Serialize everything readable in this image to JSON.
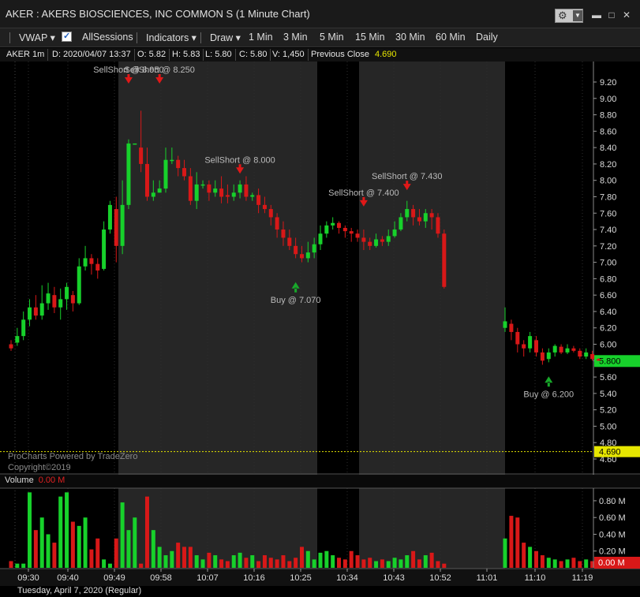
{
  "window": {
    "title": "AKER : AKERS BIOSCIENCES, INC COMMON S (1 Minute Chart)",
    "minimize": "▬",
    "restore": "□",
    "close": "✕"
  },
  "toolbar": {
    "vwap": "VWAP ▾",
    "allsessions": "AllSessions",
    "indicators": "Indicators ▾",
    "draw": "Draw ▾",
    "intervals": [
      "1 Min",
      "3 Min",
      "5 Min",
      "15 Min",
      "30 Min",
      "60 Min",
      "Daily"
    ]
  },
  "infobar": {
    "symbol": "AKER 1m",
    "date": "D: 2020/04/07 13:37",
    "open": "O: 5.82",
    "high": "H: 5.83",
    "low": "L: 5.80",
    "close": "C: 5.80",
    "volume": "V: 1,450",
    "prev_close_label": "Previous Close",
    "prev_close_value": "4.690"
  },
  "credits": {
    "line1": "ProCharts Powered by TradeZero",
    "line2": "Copyright©2019"
  },
  "volume_panel": {
    "label": "Volume",
    "value": "0.00 M"
  },
  "date_label": "Tuesday, April 7, 2020 (Regular)",
  "colors": {
    "up": "#17d12b",
    "down": "#d81818",
    "prev_close": "#e6e600",
    "last_price": "#17d12b",
    "session_band": "#262626"
  },
  "chart_data": {
    "type": "candlestick",
    "ylim": [
      4.5,
      9.3
    ],
    "y_ticks": [
      "9.20",
      "9.00",
      "8.80",
      "8.60",
      "8.40",
      "8.20",
      "8.00",
      "7.80",
      "7.60",
      "7.40",
      "7.20",
      "7.00",
      "6.80",
      "6.60",
      "6.40",
      "6.20",
      "6.00",
      "5.80",
      "5.60",
      "5.40",
      "5.20",
      "5.00",
      "4.80",
      "4.60"
    ],
    "x_ticks": [
      "09:30",
      "09:40",
      "09:49",
      "09:58",
      "10:07",
      "10:16",
      "10:25",
      "10:34",
      "10:43",
      "10:52",
      "11:01",
      "11:10",
      "11:19"
    ],
    "last_price_label": "5.800",
    "last_price": 5.8,
    "prev_close_label": "4.690",
    "prev_close": 4.69,
    "volume_ticks": [
      "0.80 M",
      "0.60 M",
      "0.40 M",
      "0.20 M"
    ],
    "volume_last_label": "0.00 M",
    "vol_ylim": [
      0,
      0.95
    ],
    "candles": [
      [
        6.0,
        5.95,
        6.05,
        5.92
      ],
      [
        6.02,
        6.1,
        6.2,
        5.98
      ],
      [
        6.1,
        6.3,
        6.4,
        6.05
      ],
      [
        6.3,
        6.45,
        6.55,
        6.22
      ],
      [
        6.45,
        6.35,
        6.6,
        6.3
      ],
      [
        6.35,
        6.5,
        6.72,
        6.3
      ],
      [
        6.5,
        6.62,
        6.75,
        6.42
      ],
      [
        6.6,
        6.45,
        6.7,
        6.38
      ],
      [
        6.45,
        6.55,
        6.68,
        6.3
      ],
      [
        6.55,
        6.7,
        6.75,
        6.42
      ],
      [
        6.6,
        6.5,
        6.65,
        6.4
      ],
      [
        6.5,
        6.95,
        7.05,
        6.48
      ],
      [
        6.95,
        7.05,
        7.2,
        6.9
      ],
      [
        7.05,
        6.98,
        7.1,
        6.85
      ],
      [
        6.98,
        6.9,
        7.05,
        6.8
      ],
      [
        6.92,
        7.4,
        7.5,
        6.9
      ],
      [
        7.4,
        7.7,
        7.75,
        7.35
      ],
      [
        7.65,
        7.2,
        7.8,
        7.0
      ],
      [
        7.2,
        7.7,
        8.0,
        7.1
      ],
      [
        7.7,
        8.45,
        8.5,
        7.65
      ],
      [
        8.45,
        8.45,
        8.45,
        8.45
      ],
      [
        8.4,
        8.2,
        8.85,
        8.1
      ],
      [
        8.2,
        7.8,
        8.4,
        7.75
      ],
      [
        7.8,
        7.85,
        8.0,
        7.75
      ],
      [
        7.85,
        7.9,
        8.0,
        7.85
      ],
      [
        7.9,
        8.25,
        8.4,
        7.85
      ],
      [
        8.25,
        8.25,
        8.4,
        8.2
      ],
      [
        8.25,
        8.15,
        8.3,
        8.05
      ],
      [
        8.15,
        8.05,
        8.25,
        8.0
      ],
      [
        8.05,
        7.75,
        8.15,
        7.7
      ],
      [
        7.75,
        7.95,
        8.1,
        7.65
      ],
      [
        7.95,
        7.95,
        8.0,
        7.9
      ],
      [
        7.95,
        7.85,
        8.0,
        7.75
      ],
      [
        7.85,
        7.9,
        8.0,
        7.8
      ],
      [
        7.9,
        7.8,
        8.05,
        7.72
      ],
      [
        7.82,
        7.8,
        7.95,
        7.72
      ],
      [
        7.8,
        7.85,
        7.95,
        7.75
      ],
      [
        7.85,
        7.95,
        8.0,
        7.78
      ],
      [
        7.95,
        7.8,
        8.05,
        7.75
      ],
      [
        7.8,
        7.82,
        7.85,
        7.75
      ],
      [
        7.82,
        7.7,
        7.9,
        7.6
      ],
      [
        7.7,
        7.65,
        7.8,
        7.6
      ],
      [
        7.65,
        7.55,
        7.7,
        7.45
      ],
      [
        7.55,
        7.4,
        7.6,
        7.3
      ],
      [
        7.4,
        7.3,
        7.5,
        7.2
      ],
      [
        7.3,
        7.2,
        7.4,
        7.15
      ],
      [
        7.2,
        7.1,
        7.3,
        7.05
      ],
      [
        7.1,
        7.05,
        7.2,
        7.0
      ],
      [
        7.05,
        7.12,
        7.25,
        7.0
      ],
      [
        7.12,
        7.22,
        7.3,
        7.05
      ],
      [
        7.22,
        7.35,
        7.45,
        7.15
      ],
      [
        7.35,
        7.45,
        7.5,
        7.3
      ],
      [
        7.45,
        7.48,
        7.55,
        7.4
      ],
      [
        7.48,
        7.42,
        7.5,
        7.35
      ],
      [
        7.42,
        7.38,
        7.45,
        7.3
      ],
      [
        7.38,
        7.35,
        7.42,
        7.25
      ],
      [
        7.35,
        7.3,
        7.4,
        7.25
      ],
      [
        7.3,
        7.25,
        7.4,
        7.15
      ],
      [
        7.25,
        7.2,
        7.3,
        7.15
      ],
      [
        7.2,
        7.28,
        7.35,
        7.18
      ],
      [
        7.28,
        7.25,
        7.32,
        7.2
      ],
      [
        7.25,
        7.32,
        7.4,
        7.2
      ],
      [
        7.32,
        7.4,
        7.5,
        7.3
      ],
      [
        7.4,
        7.55,
        7.6,
        7.38
      ],
      [
        7.55,
        7.65,
        7.75,
        7.5
      ],
      [
        7.65,
        7.55,
        7.7,
        7.45
      ],
      [
        7.55,
        7.5,
        7.65,
        7.45
      ],
      [
        7.5,
        7.6,
        7.65,
        7.42
      ],
      [
        7.6,
        7.55,
        7.65,
        7.4
      ],
      [
        7.55,
        7.35,
        7.6,
        7.3
      ],
      [
        7.35,
        6.7,
        7.4,
        6.68
      ],
      [
        6.2,
        6.28,
        6.45,
        6.15
      ],
      [
        6.25,
        6.15,
        6.3,
        6.05
      ],
      [
        6.15,
        6.0,
        6.2,
        5.9
      ],
      [
        6.0,
        5.95,
        6.05,
        5.85
      ],
      [
        5.95,
        6.1,
        6.15,
        5.9
      ],
      [
        6.05,
        5.9,
        6.1,
        5.85
      ],
      [
        5.9,
        5.8,
        5.95,
        5.75
      ],
      [
        5.82,
        5.9,
        5.95,
        5.78
      ],
      [
        5.9,
        5.98,
        6.0,
        5.85
      ],
      [
        5.97,
        5.9,
        6.0,
        5.88
      ],
      [
        5.9,
        5.95,
        6.0,
        5.88
      ],
      [
        5.95,
        5.92,
        5.98,
        5.9
      ],
      [
        5.92,
        5.85,
        5.95,
        5.82
      ],
      [
        5.85,
        5.9,
        5.95,
        5.82
      ],
      [
        5.88,
        5.82,
        5.92,
        5.8
      ],
      [
        5.82,
        5.8,
        5.83,
        5.8
      ]
    ],
    "volumes": [
      0.08,
      0.05,
      0.05,
      0.9,
      0.45,
      0.6,
      0.4,
      0.3,
      0.85,
      0.9,
      0.55,
      0.5,
      0.6,
      0.22,
      0.35,
      0.1,
      0.05,
      0.35,
      0.78,
      0.45,
      0.6,
      0.05,
      0.85,
      0.45,
      0.25,
      0.15,
      0.2,
      0.3,
      0.25,
      0.25,
      0.15,
      0.1,
      0.18,
      0.15,
      0.1,
      0.08,
      0.15,
      0.18,
      0.12,
      0.15,
      0.08,
      0.15,
      0.12,
      0.1,
      0.15,
      0.08,
      0.12,
      0.25,
      0.2,
      0.1,
      0.18,
      0.2,
      0.15,
      0.12,
      0.1,
      0.2,
      0.15,
      0.1,
      0.12,
      0.08,
      0.1,
      0.08,
      0.12,
      0.1,
      0.15,
      0.2,
      0.1,
      0.15,
      0.18,
      0.08,
      0.05,
      0.35,
      0.62,
      0.6,
      0.3,
      0.25,
      0.2,
      0.15,
      0.12,
      0.1,
      0.08,
      0.1,
      0.12,
      0.08,
      0.1,
      0.08,
      0.05
    ],
    "annotations": [
      {
        "text": "SellShort @ 8.950",
        "i": 19,
        "price": 9.2,
        "dir": "down"
      },
      {
        "text": "SellShort @ 8.250",
        "i": 24,
        "price": 9.2,
        "dir": "down"
      },
      {
        "text": "SellShort @ 8.000",
        "i": 37,
        "price": 8.1,
        "dir": "down"
      },
      {
        "text": "Buy @ 7.070",
        "i": 46,
        "price": 6.7,
        "dir": "up"
      },
      {
        "text": "SellShort @ 7.400",
        "i": 57,
        "price": 7.7,
        "dir": "down"
      },
      {
        "text": "SellShort @ 7.430",
        "i": 64,
        "price": 7.9,
        "dir": "down"
      },
      {
        "text": "Buy @ 6.200",
        "i": 78,
        "price": 5.55,
        "dir": "up"
      }
    ]
  }
}
